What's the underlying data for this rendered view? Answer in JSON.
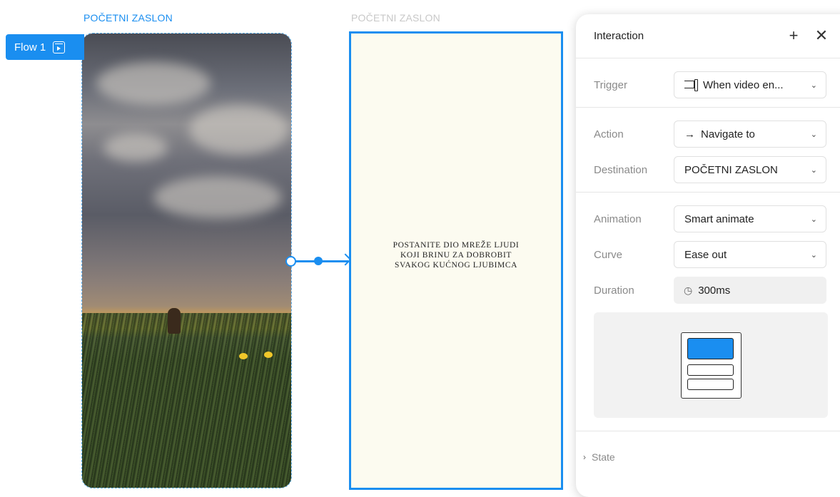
{
  "canvas": {
    "frame_left_title": "POČETNI ZASLON",
    "frame_right_title": "POČETNI ZASLON",
    "flow_badge": {
      "label": "Flow 1",
      "icon": "play-frame-icon"
    },
    "destination_frame_text": "POSTANITE DIO MREŽE LJUDI KOJI BRINU ZA DOBROBIT SVAKOG KUĆNOG LJUBIMCA",
    "accent_color": "#1a8ef0",
    "destination_bg": "#fcfbf0"
  },
  "panel": {
    "title": "Interaction",
    "add_icon": "plus-icon",
    "close_icon": "close-icon",
    "trigger": {
      "label": "Trigger",
      "value": "When video en...",
      "icon": "video-end-icon"
    },
    "action": {
      "label": "Action",
      "value": "Navigate to",
      "icon": "arrow-right-icon",
      "icon_glyph": "→"
    },
    "destination": {
      "label": "Destination",
      "value": "POČETNI ZASLON"
    },
    "animation": {
      "label": "Animation",
      "value": "Smart animate"
    },
    "curve": {
      "label": "Curve",
      "value": "Ease out"
    },
    "duration": {
      "label": "Duration",
      "value": "300ms",
      "icon": "timer-icon"
    },
    "state": {
      "label": "State",
      "caret": "›"
    }
  }
}
